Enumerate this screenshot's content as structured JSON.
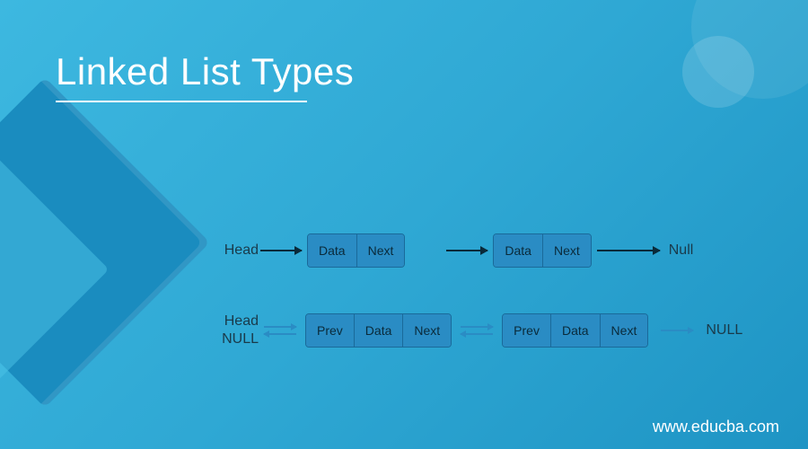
{
  "title": "Linked List Types",
  "footer": "www.educba.com",
  "singly": {
    "head_label": "Head",
    "null_label": "Null",
    "node_cells": [
      "Data",
      "Next"
    ]
  },
  "doubly": {
    "head_label": "Head",
    "null_left": "NULL",
    "null_right": "NULL",
    "node_cells": [
      "Prev",
      "Data",
      "Next"
    ]
  }
}
